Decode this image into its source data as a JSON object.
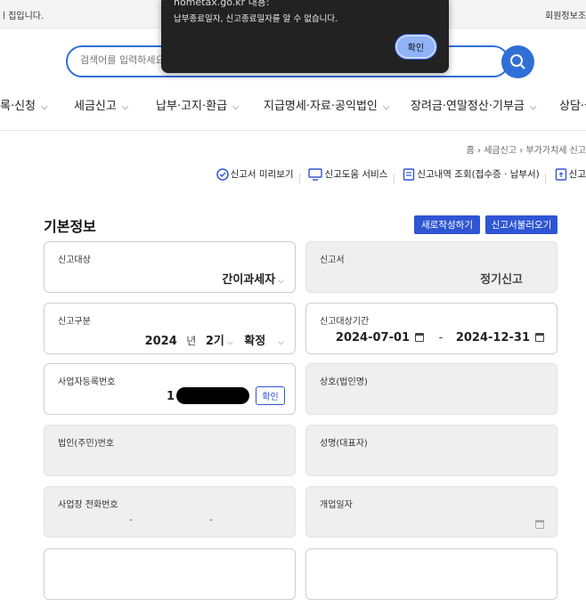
{
  "top_bar": {
    "left_text": "ㅣ집입니다.",
    "right_text": "회원정보조"
  },
  "search": {
    "placeholder": "검색어를 입력하세요"
  },
  "nav": [
    {
      "label": "록·신청"
    },
    {
      "label": "세금신고"
    },
    {
      "label": "납부·고지·환급"
    },
    {
      "label": "지급명세·자료·공익법인"
    },
    {
      "label": "장려금·연말정산·기부금"
    },
    {
      "label": "상담·불"
    }
  ],
  "breadcrumb": {
    "home": "홈",
    "level1": "세금신고",
    "level2": "부가가치세 신고"
  },
  "quick_links": {
    "preview": "신고서 미리보기",
    "help": "신고도움 서비스",
    "history": "신고내역 조회(접수증 · 납부서)",
    "more": "신고"
  },
  "section": {
    "title": "기본정보",
    "btn_new": "새로작성하기",
    "btn_load": "신고서불러오기"
  },
  "fields": {
    "target": {
      "label": "신고대상",
      "value": "간이과세자"
    },
    "report_form": {
      "label": "신고서",
      "value": "정기신고"
    },
    "report_type": {
      "label": "신고구분",
      "year": "2024",
      "year_unit": "년",
      "period": "2기",
      "status": "확정"
    },
    "report_period": {
      "label": "신고대상기간",
      "start": "2024-07-01",
      "sep": "-",
      "end": "2024-12-31"
    },
    "biz_no": {
      "label": "사업자등록번호",
      "prefix": "1",
      "confirm_btn": "확인"
    },
    "company": {
      "label": "상호(법인명)"
    },
    "corp_no": {
      "label": "법인(주민)번호"
    },
    "rep_name": {
      "label": "성명(대표자)"
    },
    "phone": {
      "label": "사업장 전화번호",
      "sep1": "-",
      "sep2": "-"
    },
    "open_date": {
      "label": "개업일자"
    }
  },
  "modal": {
    "title": "hometax.go.kr 내용:",
    "message": "납부종료일자, 신고종료일자를 알 수 없습니다.",
    "ok": "확인"
  },
  "colors": {
    "primary": "#2f55d4",
    "search_border": "#2f6fd6",
    "modal_bg": "#222222"
  }
}
